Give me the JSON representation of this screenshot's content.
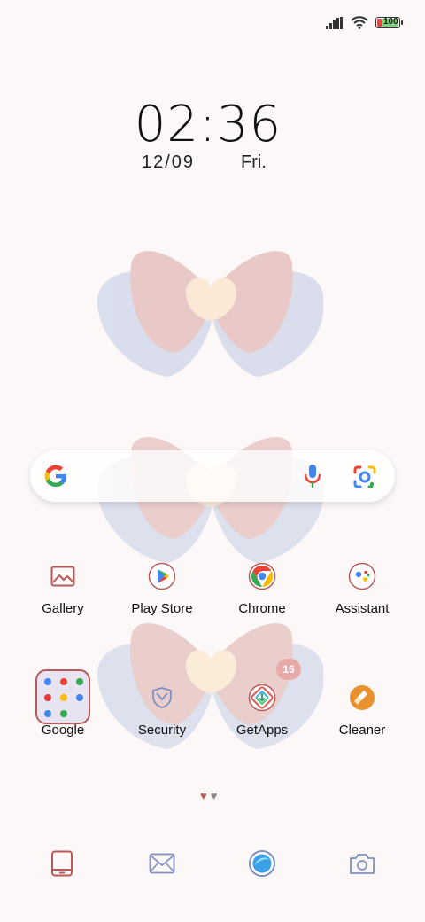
{
  "status_bar": {
    "battery_level": "100",
    "battery_color": "#7fd07a",
    "icons": [
      "signal-icon",
      "wifi-icon",
      "battery-icon"
    ]
  },
  "clock": {
    "time": "02:36",
    "date": "12/09",
    "day": "Fri."
  },
  "search_bar": {
    "icons": [
      "google-g-icon",
      "microphone-icon",
      "google-lens-icon"
    ]
  },
  "apps_row1": [
    {
      "label": "Gallery",
      "icon": "gallery-icon"
    },
    {
      "label": "Play Store",
      "icon": "play-store-icon"
    },
    {
      "label": "Chrome",
      "icon": "chrome-icon"
    },
    {
      "label": "Assistant",
      "icon": "assistant-icon"
    }
  ],
  "apps_row2": [
    {
      "label": "Google",
      "icon": "google-folder-icon"
    },
    {
      "label": "Security",
      "icon": "security-icon"
    },
    {
      "label": "GetApps",
      "icon": "getapps-icon",
      "badge": "16"
    },
    {
      "label": "Cleaner",
      "icon": "cleaner-icon"
    }
  ],
  "page_indicator": {
    "current": 1,
    "total": 2
  },
  "dock": [
    "phone-icon",
    "messages-icon",
    "browser-icon",
    "camera-icon"
  ],
  "colors": {
    "accent_red": "#b85a5a",
    "accent_blue": "#8090c0",
    "background": "#fcf8f7"
  }
}
